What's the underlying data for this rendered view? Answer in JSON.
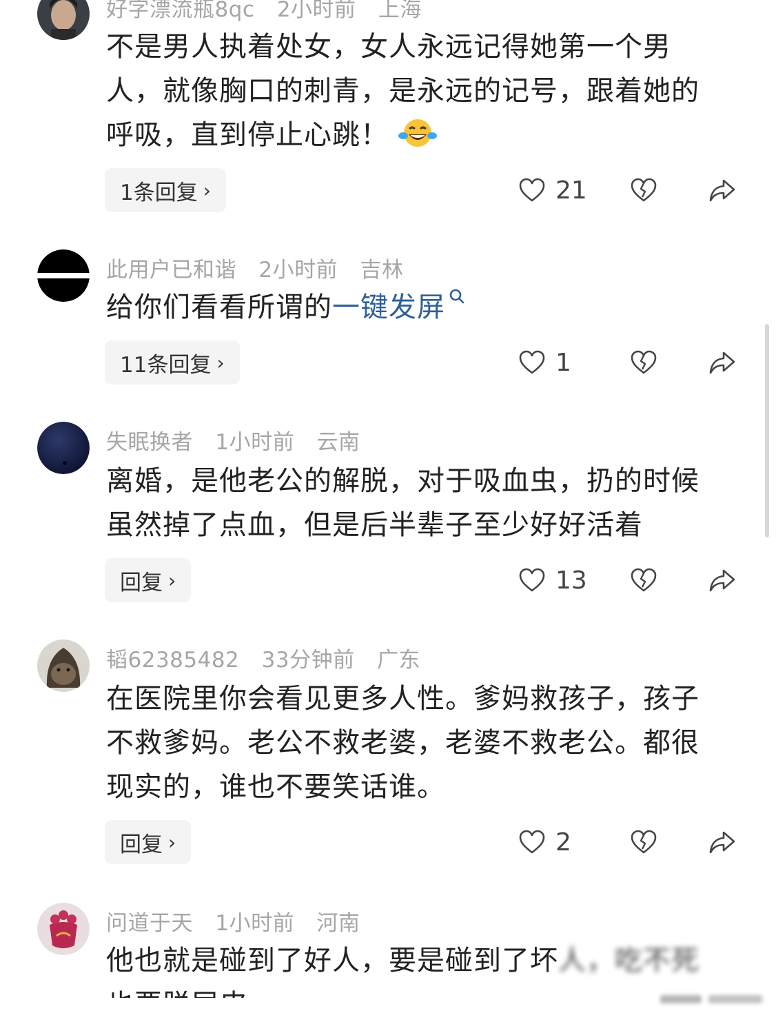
{
  "comments": [
    {
      "user": "好字漂流瓶8qc",
      "time": "2小时前",
      "location": "上海",
      "text_lines": [
        "不是男人执着处女，女人永远记得她第一个男",
        "人，就像胸口的刺青，是永远的记号，跟着她的",
        "呼吸，直到停止心跳！"
      ],
      "emoji": "laughing-tears-emoji",
      "reply_label": "1条回复",
      "likes": "21"
    },
    {
      "user": "此用户已和谐",
      "time": "2小时前",
      "location": "吉林",
      "text_prefix": "给你们看看所谓的",
      "text_link": "一键发屏",
      "reply_label": "11条回复",
      "likes": "1"
    },
    {
      "user": "失眠换者",
      "time": "1小时前",
      "location": "云南",
      "text_lines": [
        "离婚，是他老公的解脱，对于吸血虫，扔的时候",
        "虽然掉了点血，但是后半辈子至少好好活着"
      ],
      "reply_label": "回复",
      "likes": "13"
    },
    {
      "user": "韬62385482",
      "time": "33分钟前",
      "location": "广东",
      "text_lines": [
        "在医院里你会看见更多人性。爹妈救孩子，孩子",
        "不救爹妈。老公不救老婆，老婆不救老公。都很",
        "现实的，谁也不要笑话谁。"
      ],
      "reply_label": "回复",
      "likes": "2"
    },
    {
      "user": "问道于天",
      "time": "1小时前",
      "location": "河南",
      "text_line_visible": "他也就是碰到了好人，要是碰到了坏",
      "text_line_blurred": "人，吃不死",
      "text_line_cut": "也要脱层皮"
    }
  ],
  "colors": {
    "link": "#2f5f99",
    "meta": "#a6a6a6",
    "reply_bg": "#f4f4f4"
  },
  "icons": {
    "like": "heart-outline-icon",
    "dislike": "broken-heart-icon",
    "share": "share-arrow-icon",
    "reply_chevron": "chevron-right-icon",
    "search": "search-icon"
  }
}
